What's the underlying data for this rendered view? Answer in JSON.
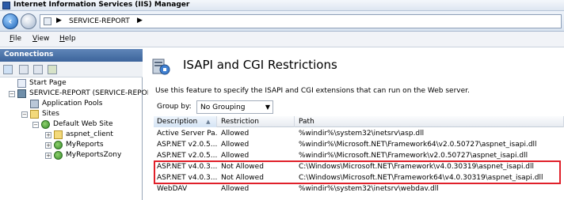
{
  "window": {
    "title": "Internet Information Services (IIS) Manager"
  },
  "address": {
    "crumb": "SERVICE-REPORT",
    "separator": "▶"
  },
  "menu": {
    "file": "File",
    "file_key": "F",
    "file_rest": "ile",
    "view": "View",
    "view_key": "V",
    "view_rest": "iew",
    "help": "Help",
    "help_key": "H",
    "help_rest": "elp"
  },
  "connections": {
    "header": "Connections",
    "tree": [
      {
        "label": "Start Page",
        "icon": "start-page-icon"
      },
      {
        "label": "SERVICE-REPORT (SERVICE-REPOR",
        "icon": "server-icon"
      },
      {
        "label": "Application Pools",
        "icon": "app-pool-icon"
      },
      {
        "label": "Sites",
        "icon": "sites-icon"
      },
      {
        "label": "Default Web Site",
        "icon": "globe-icon"
      },
      {
        "label": "aspnet_client",
        "icon": "folder-icon"
      },
      {
        "label": "MyReports",
        "icon": "app-icon"
      },
      {
        "label": "MyReportsZony",
        "icon": "app-icon"
      }
    ]
  },
  "feature": {
    "title": "ISAPI and CGI Restrictions",
    "description": "Use this feature to specify the ISAPI and CGI extensions that can run on the Web server.",
    "group_by_label": "Group by:",
    "group_by_value": "No Grouping"
  },
  "grid": {
    "columns": [
      "Description",
      "Restriction",
      "Path"
    ],
    "sort_indicator": "▲",
    "rows": [
      {
        "description": "Active Server Pa...",
        "restriction": "Allowed",
        "path": "%windir%\\system32\\inetsrv\\asp.dll"
      },
      {
        "description": "ASP.NET v2.0.5...",
        "restriction": "Allowed",
        "path": "%windir%\\Microsoft.NET\\Framework64\\v2.0.50727\\aspnet_isapi.dll"
      },
      {
        "description": "ASP.NET v2.0.5...",
        "restriction": "Allowed",
        "path": "%windir%\\Microsoft.NET\\Framework\\v2.0.50727\\aspnet_isapi.dll"
      },
      {
        "description": "ASP.NET v4.0.3...",
        "restriction": "Not Allowed",
        "path": "C:\\Windows\\Microsoft.NET\\Framework\\v4.0.30319\\aspnet_isapi.dll"
      },
      {
        "description": "ASP.NET v4.0.3...",
        "restriction": "Not Allowed",
        "path": "C:\\Windows\\Microsoft.NET\\Framework64\\v4.0.30319\\aspnet_isapi.dll"
      },
      {
        "description": "WebDAV",
        "restriction": "Allowed",
        "path": "%windir%\\system32\\inetsrv\\webdav.dll"
      }
    ]
  },
  "colors": {
    "highlight": "#e0202a",
    "header": "#3c649b"
  }
}
